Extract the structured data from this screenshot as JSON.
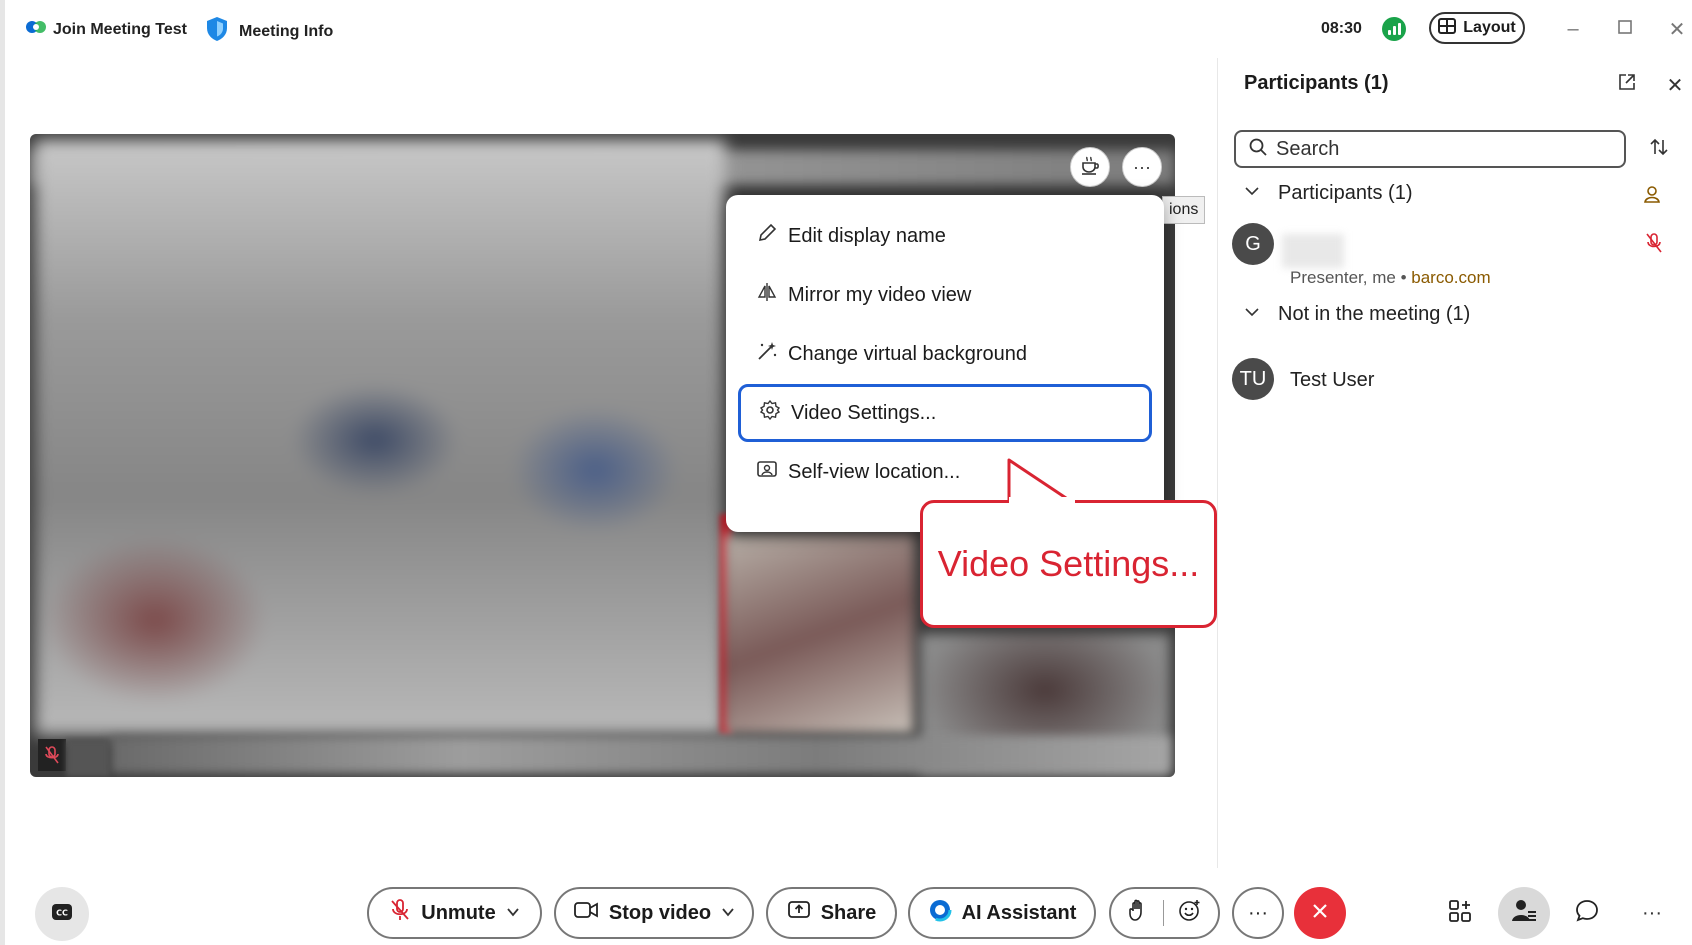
{
  "titlebar": {
    "app_title": "Join Meeting Test",
    "info_label": "Meeting Info",
    "clock": "08:30",
    "layout_label": "Layout"
  },
  "stage": {
    "tooltip_fragment": "ions"
  },
  "menu": {
    "items": [
      {
        "label": "Edit display name",
        "icon": "pencil-icon"
      },
      {
        "label": "Mirror my video view",
        "icon": "mirror-icon"
      },
      {
        "label": "Change virtual background",
        "icon": "magic-wand-icon"
      },
      {
        "label": "Video Settings...",
        "icon": "gear-icon"
      },
      {
        "label": "Self-view location...",
        "icon": "self-view-icon"
      }
    ],
    "focused_index": 3
  },
  "callout": {
    "text": "Video Settings..."
  },
  "panel": {
    "title": "Participants (1)",
    "search_placeholder": "Search",
    "sections": [
      {
        "label": "Participants (1)",
        "members": [
          {
            "initial": "G",
            "role": "Presenter, me",
            "separator": "•",
            "domain": "barco.com"
          }
        ]
      },
      {
        "label": "Not in the meeting (1)",
        "members": [
          {
            "initial": "TU",
            "name": "Test User"
          }
        ]
      }
    ]
  },
  "toolbar": {
    "unmute_label": "Unmute",
    "stop_video_label": "Stop video",
    "share_label": "Share",
    "ai_label": "AI Assistant",
    "more_label": "···",
    "overflow_label": "···"
  },
  "colors": {
    "accent_blue": "#1f5fd6",
    "callout_red": "#d92432",
    "end_call_red": "#e8303a",
    "signal_green": "#1aa34a",
    "domain_brown": "#8a5a00"
  }
}
